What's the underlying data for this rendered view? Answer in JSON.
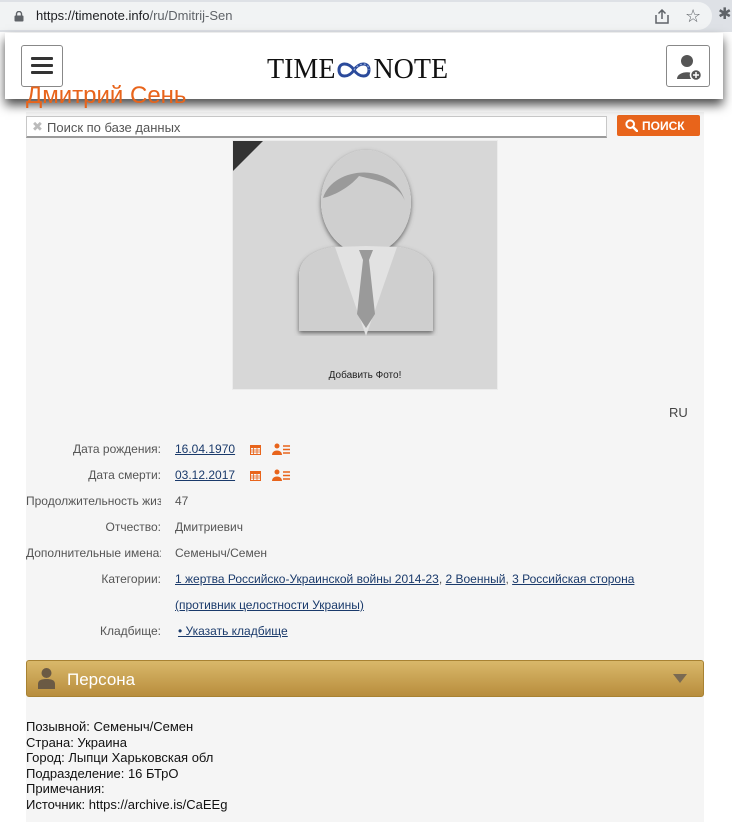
{
  "browser": {
    "url_host": "https://timenote.info",
    "url_path": "/ru/Dmitrij-Sen"
  },
  "header": {
    "logo_left": "TIME",
    "logo_right": "NOTE"
  },
  "person": {
    "name": "Дмитрий Сень"
  },
  "search": {
    "placeholder": "Поиск по базе данных",
    "button_label": "ПОИСК"
  },
  "photo": {
    "add_label": "Добавить Фото!"
  },
  "lang": "RU",
  "info": {
    "birth": {
      "label": "Дата рождения:",
      "value": "16.04.1970"
    },
    "death": {
      "label": "Дата смерти:",
      "value": "03.12.2017"
    },
    "duration": {
      "label": "Продолжительность жизни:",
      "value": "47"
    },
    "patronymic": {
      "label": "Отчество:",
      "value": "Дмитриевич"
    },
    "extra_names": {
      "label": "Дополнительные имена:",
      "value": "Семеныч/Семен"
    },
    "categories": {
      "label": "Категории:",
      "items": [
        "1 жертва Российско-Украинской войны 2014-23",
        "2 Военный",
        "3 Российская сторона",
        "(противник целостности Украины)"
      ],
      "sep": ", "
    },
    "cemetery": {
      "label": "Кладбище:",
      "link": "• Указать кладбище"
    }
  },
  "section": {
    "title": "Персона"
  },
  "details": [
    "Позывной: Семеныч/Семен",
    "Страна: Украина",
    "Город: Лыпци Харьковская обл",
    "Подразделение: 16 БТрО",
    "Примечания:",
    "Источник: https://archive.is/CaEEg"
  ],
  "colors": {
    "accent": "#e8641b",
    "section_gold": "#c9a14f",
    "link": "#1a3a6b"
  }
}
